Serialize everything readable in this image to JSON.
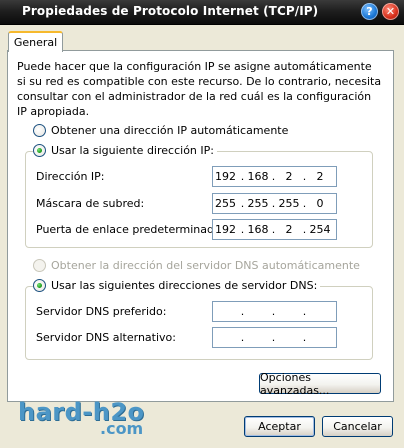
{
  "window": {
    "title": "Propiedades de Protocolo Internet (TCP/IP)",
    "help_glyph": "?",
    "close_glyph": "✕"
  },
  "tabs": [
    {
      "label": "General",
      "selected": true
    }
  ],
  "description": "Puede hacer que la configuración IP se asigne automáticamente si su red es compatible con este recurso. De lo contrario, necesita consultar con el administrador de la red cuál es la configuración IP apropiada.",
  "ip_section": {
    "auto_label": "Obtener una dirección IP automáticamente",
    "manual_label": "Usar la siguiente dirección IP:",
    "fields": [
      {
        "label": "Dirección IP:",
        "octets": [
          "192",
          "168",
          "2",
          "2"
        ]
      },
      {
        "label": "Máscara de subred:",
        "octets": [
          "255",
          "255",
          "255",
          "0"
        ]
      },
      {
        "label": "Puerta de enlace predeterminada:",
        "octets": [
          "192",
          "168",
          "2",
          "254"
        ]
      }
    ]
  },
  "dns_section": {
    "auto_label": "Obtener la dirección del servidor DNS automáticamente",
    "manual_label": "Usar las siguientes direcciones de servidor DNS:",
    "fields": [
      {
        "label": "Servidor DNS preferido:",
        "octets": [
          "",
          "",
          "",
          ""
        ]
      },
      {
        "label": "Servidor DNS alternativo:",
        "octets": [
          "",
          "",
          "",
          ""
        ]
      }
    ]
  },
  "buttons": {
    "advanced": "Opciones avanzadas...",
    "ok": "Aceptar",
    "cancel": "Cancelar"
  },
  "watermark": {
    "main": "hard-h2o",
    "sub": ".com"
  }
}
